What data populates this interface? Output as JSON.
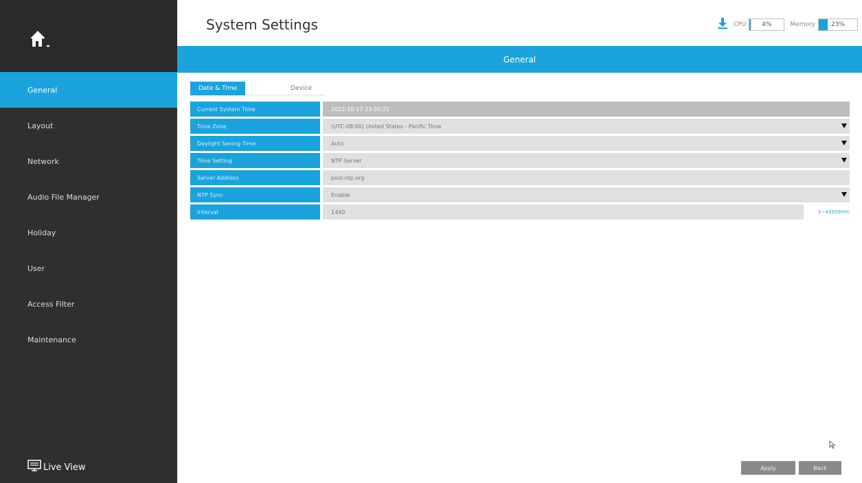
{
  "sidebar": {
    "items": [
      {
        "label": "General"
      },
      {
        "label": "Layout"
      },
      {
        "label": "Network"
      },
      {
        "label": "Audio File Manager"
      },
      {
        "label": "Holiday"
      },
      {
        "label": "User"
      },
      {
        "label": "Access Filter"
      },
      {
        "label": "Maintenance"
      }
    ],
    "live_view_label": "Live View"
  },
  "header": {
    "title": "System Settings",
    "cpu_label": "CPU",
    "cpu_value": "4%",
    "cpu_percent": 4,
    "memory_label": "Memory",
    "memory_value": "23%",
    "memory_percent": 23
  },
  "section": {
    "title": "General"
  },
  "tabs": [
    {
      "label": "Date & Time",
      "active": true
    },
    {
      "label": "Device",
      "active": false
    }
  ],
  "fields": [
    {
      "label": "Current System Time",
      "value": "2022-10-17 23:00:22"
    },
    {
      "label": "Time Zone",
      "value": "(UTC-08:00) United States - Pacific Time"
    },
    {
      "label": "Daylight Saving Time",
      "value": "Auto"
    },
    {
      "label": "Time Setting",
      "value": "NTP Server"
    },
    {
      "label": "Server Address",
      "value": "pool.ntp.org"
    },
    {
      "label": "NTP Sync",
      "value": "Enable"
    },
    {
      "label": "Interval",
      "value": "1440",
      "hint": "1~43200min"
    }
  ],
  "buttons": {
    "apply": "Apply",
    "back": "Back"
  },
  "colors": {
    "accent": "#1aa3dc",
    "sidebar": "#2f2f2f"
  }
}
